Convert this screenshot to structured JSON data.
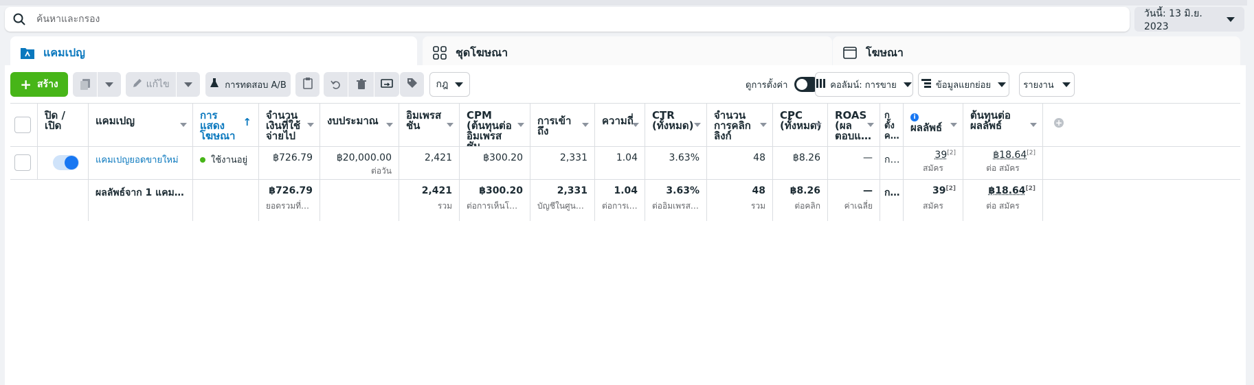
{
  "search": {
    "placeholder": "ค้นหาและกรอง"
  },
  "date_picker": {
    "label": "วันนี้: 13 มิ.ย. 2023"
  },
  "tabs": [
    {
      "label": "แคมเปญ",
      "icon": "folder-icon",
      "active": true
    },
    {
      "label": "ชุดโฆษณา",
      "icon": "grid-icon",
      "active": false
    },
    {
      "label": "โฆษณา",
      "icon": "window-icon",
      "active": false
    }
  ],
  "toolbar": {
    "create_label": "สร้าง",
    "edit_label": "แก้ไข",
    "ab_test_label": "การทดสอบ A/B",
    "rules_label": "กฎ",
    "view_settings_label": "ดูการตั้งค่า",
    "columns_label": "คอลัมน์: การขาย",
    "breakdown_label": "ข้อมูลแยกย่อย",
    "reports_label": "รายงาน"
  },
  "colors": {
    "accent": "#0a78be",
    "create": "#47b518",
    "toggle": "#1877f2"
  },
  "table": {
    "headers": {
      "toggle": "ปิด / เปิด",
      "campaign": "แคมเปญ",
      "delivery": "การแสดงโฆษณา",
      "amount_spent": "จำนวนเงินที่ใช้จ่ายไป",
      "budget": "งบประมาณ",
      "impressions": "อิมเพรสชัน",
      "cpm": "CPM (ต้นทุนต่ออิมเพรสชัน…",
      "reach": "การเข้าถึง",
      "frequency": "ความถี่",
      "ctr": "CTR (ทั้งหมด)",
      "link_clicks": "จำนวนการคลิกลิงก์",
      "cpc": "CPC (ทั้งหมด)",
      "roas": "ROAS (ผลตอบแ…",
      "attribution": "ก ตั้ง ค…",
      "results": "ผลลัพธ์",
      "cost_per_result": "ต้นทุนต่อผลลัพธ์"
    },
    "row": {
      "campaign": "แคมเปญยอดขายใหม่",
      "delivery": "ใช้งานอยู่",
      "amount_spent": "฿726.79",
      "budget": "฿20,000.00",
      "budget_sub": "ต่อวัน",
      "impressions": "2,421",
      "cpm": "฿300.20",
      "reach": "2,331",
      "frequency": "1.04",
      "ctr": "3.63%",
      "link_clicks": "48",
      "cpc": "฿8.26",
      "roas": "—",
      "attribution": "ก…",
      "results": "39",
      "results_sup": "[2]",
      "results_sub": "สมัคร",
      "cost_per_result": "฿18.64",
      "cost_per_result_sup": "[2]",
      "cost_per_result_sub": "ต่อ สมัคร"
    },
    "summary": {
      "label": "ผลลัพธ์จาก 1 แคมเ…",
      "amount_spent": "฿726.79",
      "amount_spent_sub": "ยอดรวมที่ใช้…",
      "impressions": "2,421",
      "impressions_sub": "รวม",
      "cpm": "฿300.20",
      "cpm_sub": "ต่อการเห็นโฆษ…",
      "reach": "2,331",
      "reach_sub": "บัญชีในศูนย์บั…",
      "frequency": "1.04",
      "frequency_sub": "ต่อการเข้า…",
      "ctr": "3.63%",
      "ctr_sub": "ต่ออิมเพรสชัน",
      "link_clicks": "48",
      "link_clicks_sub": "รวม",
      "cpc": "฿8.26",
      "cpc_sub": "ต่อคลิก",
      "roas": "—",
      "roas_sub": "ค่าเฉลี่ย",
      "attribution": "ก…",
      "results": "39",
      "results_sup": "[2]",
      "results_sub": "สมัคร",
      "cost_per_result": "฿18.64",
      "cost_per_result_sup": "[2]",
      "cost_per_result_sub": "ต่อ สมัคร"
    }
  }
}
